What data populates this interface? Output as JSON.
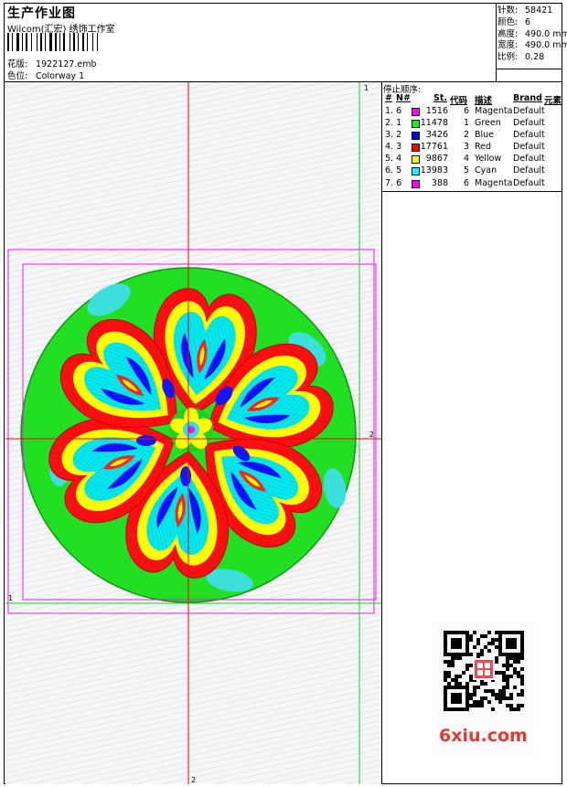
{
  "header": {
    "title": "生产作业图",
    "company": "Wilcom(汇宏) 绣饰工作室",
    "design_label": "花版:",
    "design_value": "1922127.emb",
    "colorway_label": "色位:",
    "colorway_value": "Colorway 1"
  },
  "stats": {
    "stitches_label": "针数:",
    "stitches_value": "58421",
    "colors_label": "颜色:",
    "colors_value": "6",
    "height_label": "高度:",
    "height_value": "490.0 mm",
    "width_label": "宽度:",
    "width_value": "490.0 mm",
    "scale_label": "比例:",
    "scale_value": "0.28"
  },
  "stop_sequence": {
    "title": "停止顺序:",
    "headers": [
      "#",
      "N#",
      "St.",
      "代码",
      "描述",
      "Brand",
      "元素"
    ],
    "rows": [
      {
        "index": "1. 6",
        "color": "#ff00ff",
        "stitches": "1516",
        "code": "6",
        "desc": "Magenta",
        "brand": "Default"
      },
      {
        "index": "2. 1",
        "color": "#00ff00",
        "stitches": "11478",
        "code": "1",
        "desc": "Green",
        "brand": "Default"
      },
      {
        "index": "3. 2",
        "color": "#0000ff",
        "stitches": "3426",
        "code": "2",
        "desc": "Blue",
        "brand": "Default"
      },
      {
        "index": "4. 3",
        "color": "#ff0000",
        "stitches": "17761",
        "code": "3",
        "desc": "Red",
        "brand": "Default"
      },
      {
        "index": "5. 4",
        "color": "#ffff00",
        "stitches": "9867",
        "code": "4",
        "desc": "Yellow",
        "brand": "Default"
      },
      {
        "index": "6. 5",
        "color": "#00ffff",
        "stitches": "13983",
        "code": "5",
        "desc": "Cyan",
        "brand": "Default"
      },
      {
        "index": "7. 6",
        "color": "#ff00ff",
        "stitches": "388",
        "code": "6",
        "desc": "Magenta",
        "brand": "Default"
      }
    ]
  },
  "canvas": {
    "marker_top": "1",
    "marker_right": "2",
    "marker_left": "1",
    "marker_bottom": "2"
  },
  "watermark": "6xiu.com",
  "qr_stamp": "秀网 logo"
}
